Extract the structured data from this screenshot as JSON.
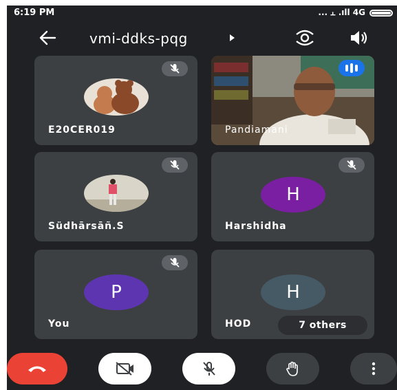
{
  "status_bar": {
    "time": "6:19 PM",
    "network": "... ⫠ .ıll 4G"
  },
  "header": {
    "meeting_code": "vmi-ddks-pqg"
  },
  "participants": [
    {
      "name": "E20CER019",
      "type": "photo",
      "muted": true
    },
    {
      "name": "Pandiamani",
      "type": "video",
      "speaking": true
    },
    {
      "name": "Südhārsāñ.S",
      "type": "photo",
      "muted": true
    },
    {
      "name": "Harshidha",
      "type": "letter",
      "initial": "H",
      "color": "#7b1fa2",
      "muted": true
    },
    {
      "name": "You",
      "type": "letter",
      "initial": "P",
      "color": "#5e35b1",
      "muted": true
    },
    {
      "name": "HOD",
      "type": "letter",
      "initial": "H",
      "color": "#455a64",
      "muted": false
    }
  ],
  "others_chip": "7 others",
  "colors": {
    "background": "#202124",
    "tile": "#3c4043",
    "end_call": "#ea4335",
    "control_button": "#ffffff"
  },
  "controls": [
    "end-call",
    "camera-off",
    "mic-off",
    "raise-hand",
    "more-options"
  ]
}
